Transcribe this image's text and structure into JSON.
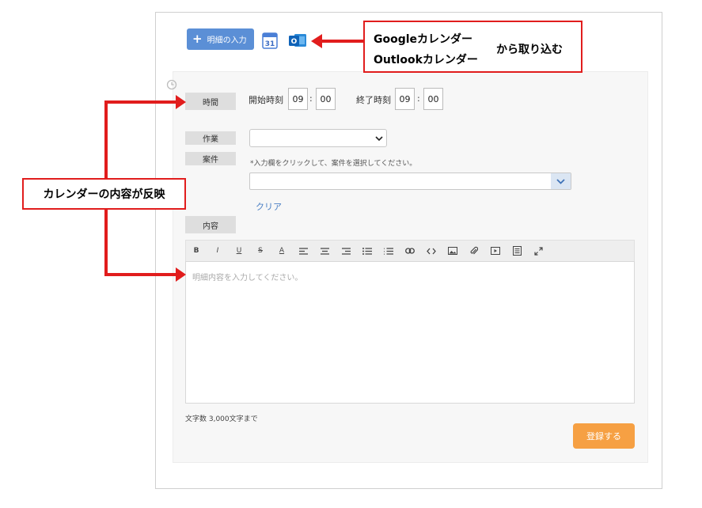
{
  "header": {
    "add_button_label": "明細の入力",
    "add_button_icon": "plus-icon",
    "google_calendar_day": "31",
    "outlook_letter": "O"
  },
  "time": {
    "label": "時間",
    "start_label": "開始時刻",
    "start_hour": "09",
    "start_minute": "00",
    "end_label": "終了時刻",
    "end_hour": "09",
    "end_minute": "00",
    "separator": ":"
  },
  "work": {
    "label": "作業",
    "selected": ""
  },
  "case": {
    "label": "案件",
    "hint": "*入力欄をクリックして、案件を選択してください。",
    "selected": "",
    "clear_label": "クリア"
  },
  "content": {
    "label": "内容",
    "placeholder": "明細内容を入力してください。",
    "toolbar": [
      "B",
      "I",
      "U",
      "S",
      "A",
      "align-left",
      "align-center",
      "align-right",
      "bullet-list",
      "numbered-list",
      "link",
      "code",
      "image",
      "attachment",
      "video",
      "table",
      "fullscreen"
    ]
  },
  "char_limit": "文字数 3,000文字まで",
  "submit_label": "登録する",
  "annotations": {
    "import_line1": "Googleカレンダー",
    "import_line2": "Outlookカレンダー",
    "import_suffix": "から取り込む",
    "reflect": "カレンダーの内容が反映"
  },
  "colors": {
    "accent_blue": "#5b8fd6",
    "submit_orange": "#f6a043",
    "annotation_red": "#e11d1d",
    "link_blue": "#4a7fc4"
  }
}
